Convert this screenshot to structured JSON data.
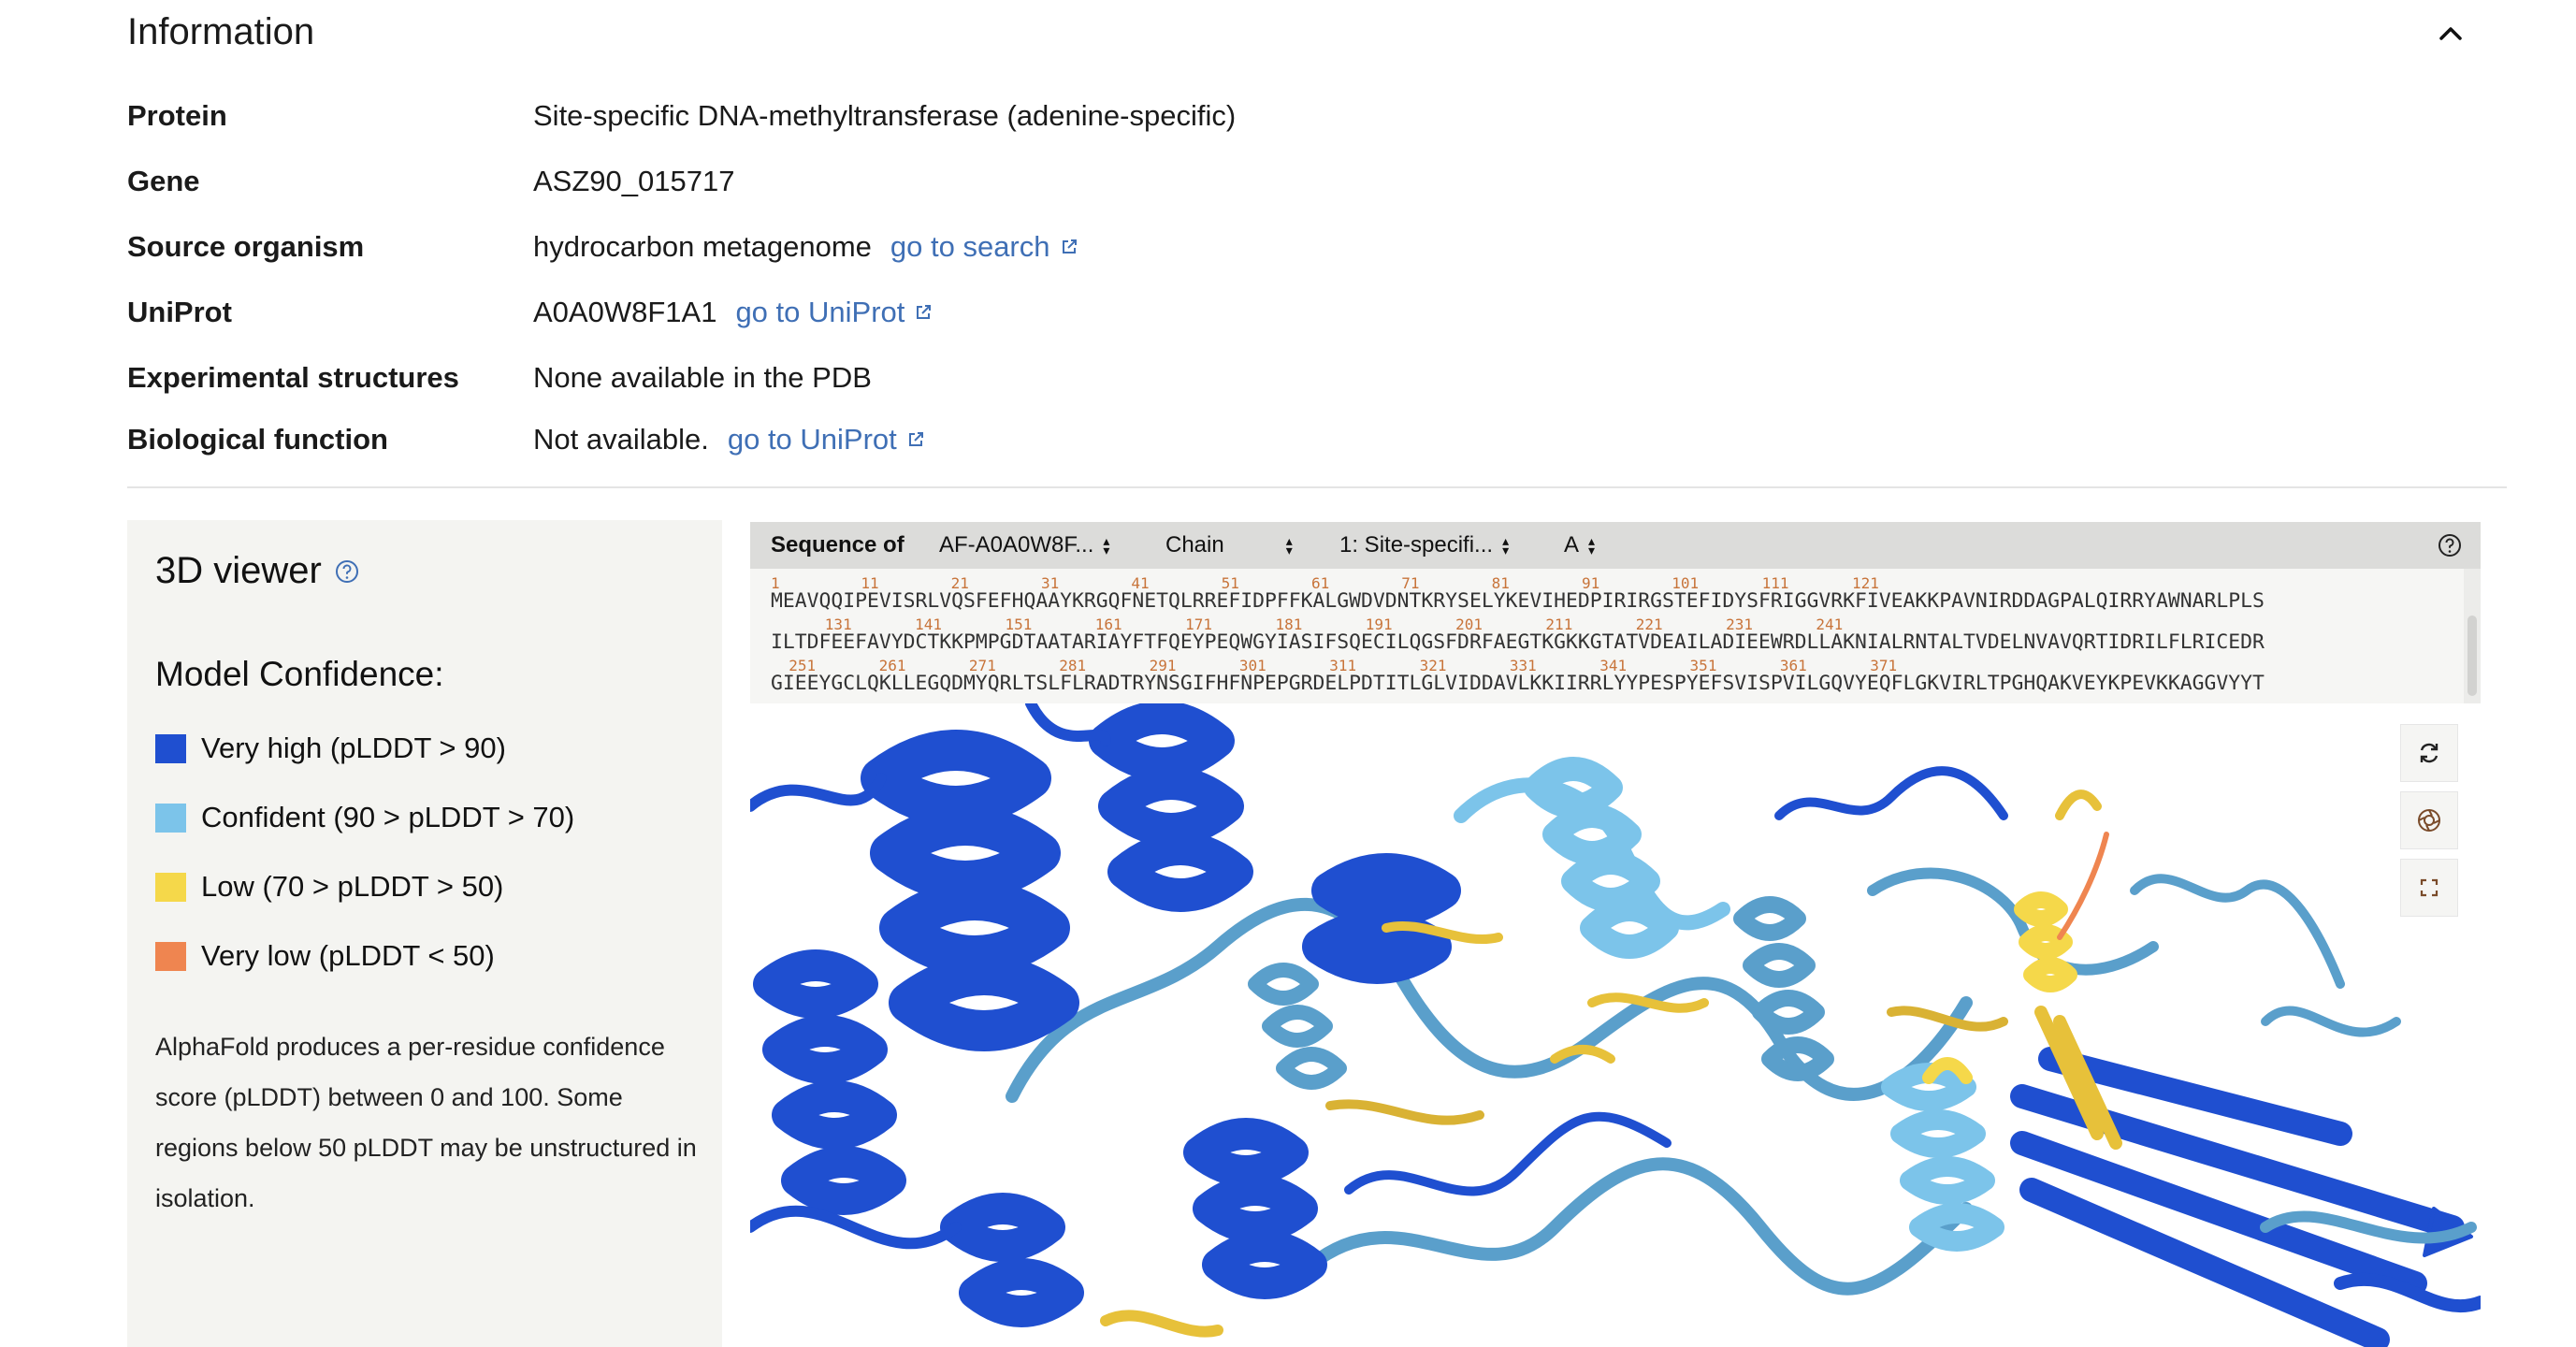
{
  "info": {
    "title": "Information",
    "rows": [
      {
        "label": "Protein",
        "value": "Site-specific DNA-methyltransferase (adenine-specific)"
      },
      {
        "label": "Gene",
        "value": "ASZ90_015717"
      },
      {
        "label": "Source organism",
        "value": "hydrocarbon metagenome",
        "link": "go to search"
      },
      {
        "label": "UniProt",
        "value": "A0A0W8F1A1",
        "link": "go to UniProt"
      },
      {
        "label": "Experimental structures",
        "value": "None available in the PDB"
      },
      {
        "label": "Biological function",
        "value": "Not available.",
        "link": "go to UniProt"
      }
    ]
  },
  "viewer": {
    "title": "3D viewer",
    "confidence_title": "Model Confidence:",
    "legend": [
      {
        "label": "Very high (pLDDT > 90)",
        "color": "#1f4fd0"
      },
      {
        "label": "Confident (90 > pLDDT > 70)",
        "color": "#7cc4ea"
      },
      {
        "label": "Low (70 > pLDDT > 50)",
        "color": "#f5d84a"
      },
      {
        "label": "Very low (pLDDT < 50)",
        "color": "#ef8550"
      }
    ],
    "explanation": "AlphaFold produces a per-residue confidence score (pLDDT) between 0 and 100. Some regions below 50 pLDDT may be unstructured in isolation."
  },
  "sequence": {
    "label": "Sequence of",
    "entry_select": "AF-A0A0W8F...",
    "chain_select": "Chain",
    "entity_select": "1: Site-specifi...",
    "chain_id_select": "A",
    "line1_nums": "1         11        21        31        41        51        61        71        81        91        101       111       121",
    "line1": "MEAVQQIPEVISRLVQSFEFHQAAYKRGQFNETQLRREFIDPFFKALGWDVDNTKRYSELYKEVIHEDPIRIRGSTEFIDYSFRIGGVRKFIVEAKKPAVNIRDDAGPALQIRRYAWNARLPLS",
    "line2_nums": "      131       141       151       161       171       181       191       201       211       221       231       241",
    "line2": "ILTDFEEFAVYDCTKKPMPGDTAATARIAYFTFQEYPEQWGYIASIFSQECILQGSFDRFAEGTKGKKGTATVDEAILADIEEWRDLLAKNIALRNTALTVDELNVAVQRTIDRILFLRICEDR",
    "line3_nums": "  251       261       271       281       291       301       311       321       331       341       351       361       371",
    "line3": "GIEEYGCLQKLLEGQDMYQRLTSLFLRADTRYNSGIFHFNPEPGRDELPDTITLGLVIDDAVLKKIIRRLYYPESPYEFSVISPVILGQVYEQFLGKVIRLTPGHQAKVEYKPEVKKAGGVYYT"
  },
  "colors": {
    "very_high": "#1f4fd0",
    "confident": "#7cc4ea",
    "confident_dark": "#5a9fcb",
    "low": "#f5d84a",
    "very_low": "#ef8550",
    "link": "#3f6fb5"
  },
  "controls": [
    "rotate-icon",
    "camera-icon",
    "fullscreen-icon"
  ]
}
